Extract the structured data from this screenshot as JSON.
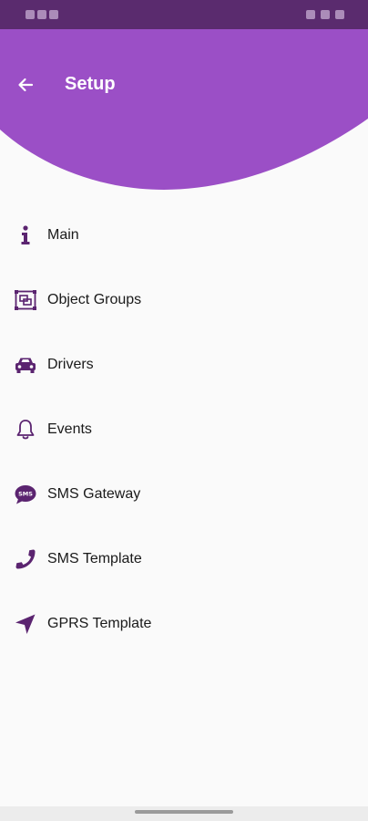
{
  "header": {
    "title": "Setup"
  },
  "colors": {
    "primary": "#9b4fc6",
    "status_bar": "#5a2b6e",
    "icon": "#5b2470"
  },
  "menu": {
    "items": [
      {
        "label": "Main",
        "icon": "info-icon"
      },
      {
        "label": "Object Groups",
        "icon": "object-groups-icon"
      },
      {
        "label": "Drivers",
        "icon": "car-icon"
      },
      {
        "label": "Events",
        "icon": "bell-icon"
      },
      {
        "label": "SMS Gateway",
        "icon": "sms-icon"
      },
      {
        "label": "SMS Template",
        "icon": "phone-icon"
      },
      {
        "label": "GPRS Template",
        "icon": "location-arrow-icon"
      }
    ]
  }
}
